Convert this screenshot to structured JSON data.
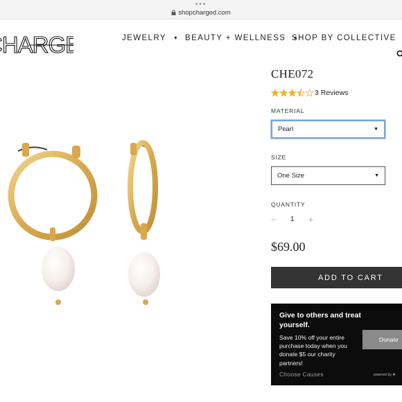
{
  "browser": {
    "dots": "•••",
    "url": "shopcharged.com"
  },
  "header": {
    "logo_text": "CHARGED",
    "nav": [
      {
        "label": "JEWELRY"
      },
      {
        "label": "BEAUTY + WELLNESS"
      },
      {
        "label": "SHOP BY COLLECTIVE"
      }
    ]
  },
  "product": {
    "sku": "CHE072",
    "rating": 3.5,
    "rating_max": 5,
    "reviews_label": "3 Reviews",
    "material_label": "MATERIAL",
    "material_value": "Pearl",
    "size_label": "SIZE",
    "size_value": "One Size",
    "quantity_label": "QUANTITY",
    "quantity_minus": "−",
    "quantity_value": "1",
    "quantity_plus": "+",
    "price": "$69.00",
    "add_to_cart": "ADD TO CART"
  },
  "donation": {
    "title": "Give to others and treat yourself.",
    "text": "Save 10% off your entire purchase today when you donate $5 our charity partners!",
    "button": "Donate",
    "link": "Choose Causes",
    "powered_by": "powered by"
  },
  "colors": {
    "star": "#e8b53a",
    "gold": "#e2b763",
    "button_dark": "#333333",
    "donate_bg": "#0c0c0c",
    "focus_border": "#7aa3d6"
  }
}
